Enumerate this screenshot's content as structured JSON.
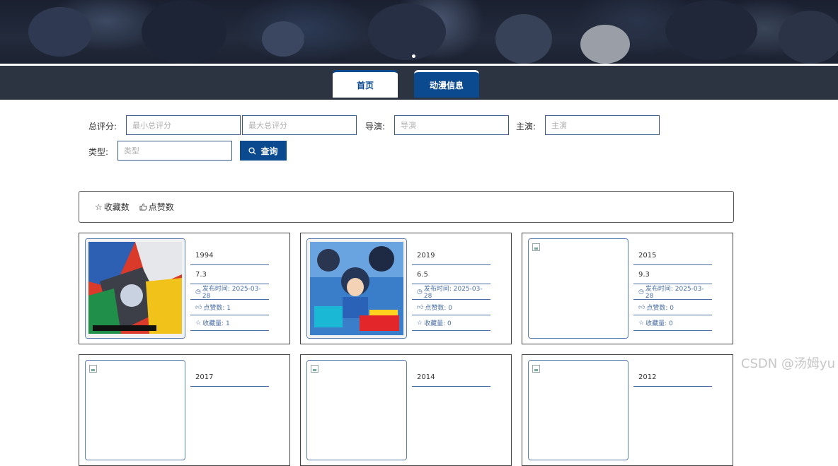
{
  "nav": {
    "home_label": "首页",
    "anime_label": "动漫信息"
  },
  "search": {
    "score_label": "总评分:",
    "min_score_placeholder": "最小总评分",
    "max_score_placeholder": "最大总评分",
    "director_label": "导演:",
    "director_placeholder": "导演",
    "actor_label": "主演:",
    "actor_placeholder": "主演",
    "type_label": "类型:",
    "type_placeholder": "类型",
    "button_label": "查询"
  },
  "sort": {
    "favorites_label": "收藏数",
    "likes_label": "点赞数"
  },
  "cards": [
    {
      "year": "1994",
      "score": "7.3",
      "publish_time": "发布时间: 2025-03-28",
      "likes": "点赞数: 1",
      "favorites": "收藏量: 1"
    },
    {
      "year": "2019",
      "score": "6.5",
      "publish_time": "发布时间: 2025-03-28",
      "likes": "点赞数: 0",
      "favorites": "收藏量: 0"
    },
    {
      "year": "2015",
      "score": "9.3",
      "publish_time": "发布时间: 2025-03-28",
      "likes": "点赞数: 0",
      "favorites": "收藏量: 0"
    },
    {
      "year": "2017"
    },
    {
      "year": "2014"
    },
    {
      "year": "2012"
    }
  ],
  "watermark": "CSDN @汤姆yu",
  "colors": {
    "accent": "#0b4a8f",
    "navbar": "#2c3341",
    "info_text": "#4a6fa5"
  }
}
